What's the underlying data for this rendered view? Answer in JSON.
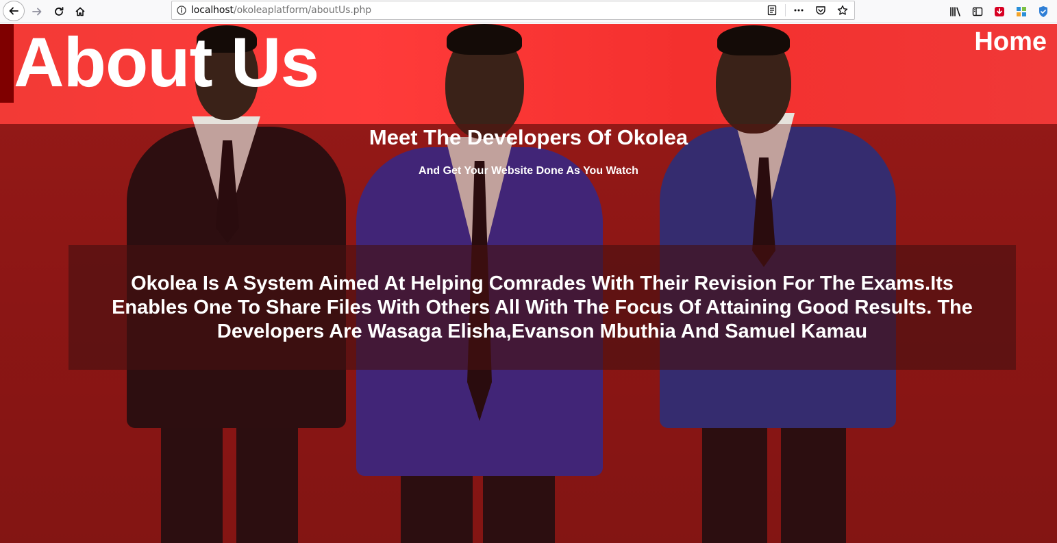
{
  "browser": {
    "url_host": "localhost",
    "url_path": "/okoleaplatform/aboutUs.php",
    "toolbar_icons": [
      "back-icon",
      "forward-icon",
      "reload-icon",
      "home-icon"
    ],
    "url_icons": [
      "info-icon",
      "reader-view-icon",
      "more-icon",
      "pocket-icon",
      "bookmark-star-icon"
    ],
    "right_icons": [
      "library-icon",
      "sidebar-icon",
      "download-icon",
      "extension-icon",
      "extension-shield-icon"
    ]
  },
  "page": {
    "title": "About Us",
    "home_link": "Home",
    "heading": "Meet The Developers Of Okolea",
    "subheading": "And Get Your Website Done As You Watch",
    "description": "Okolea Is A System Aimed At Helping Comrades With Their Revision For The Exams.Its Enables One To Share Files With Others All With The Focus Of Attaining Good Results. The Developers Are Wasaga Elisha,Evanson Mbuthia And Samuel Kamau",
    "colors": {
      "banner_red": "#ff3b3a",
      "lower_red": "#9a1c1a",
      "title_accent": "#7f0000",
      "text": "#ffffff"
    }
  }
}
